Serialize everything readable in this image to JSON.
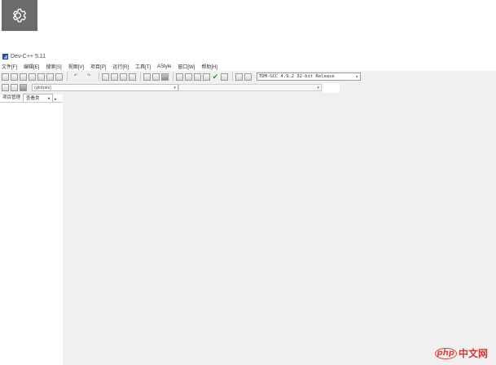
{
  "window": {
    "title": "Dev-C++ 5.11"
  },
  "menubar": {
    "items": [
      {
        "label": "文件[F]"
      },
      {
        "label": "编辑[E]"
      },
      {
        "label": "搜索[S]"
      },
      {
        "label": "视图[V]"
      },
      {
        "label": "项目[P]"
      },
      {
        "label": "运行[R]"
      },
      {
        "label": "工具[T]"
      },
      {
        "label": "AStyle"
      },
      {
        "label": "窗口[W]"
      },
      {
        "label": "帮助[H]"
      }
    ]
  },
  "toolbar": {
    "compiler_value": "TDM-GCC 4.9.2 32-bit Release",
    "scope_value": "(globals)"
  },
  "left_panel": {
    "tabs": [
      {
        "label": "项目管理"
      },
      {
        "label": "查看类"
      }
    ]
  },
  "watermark": {
    "php": "php",
    "cn": "中文网"
  },
  "icons": {
    "settings": "gear-icon",
    "app": "devcpp-icon",
    "dropdown": "chevron-down-icon"
  }
}
